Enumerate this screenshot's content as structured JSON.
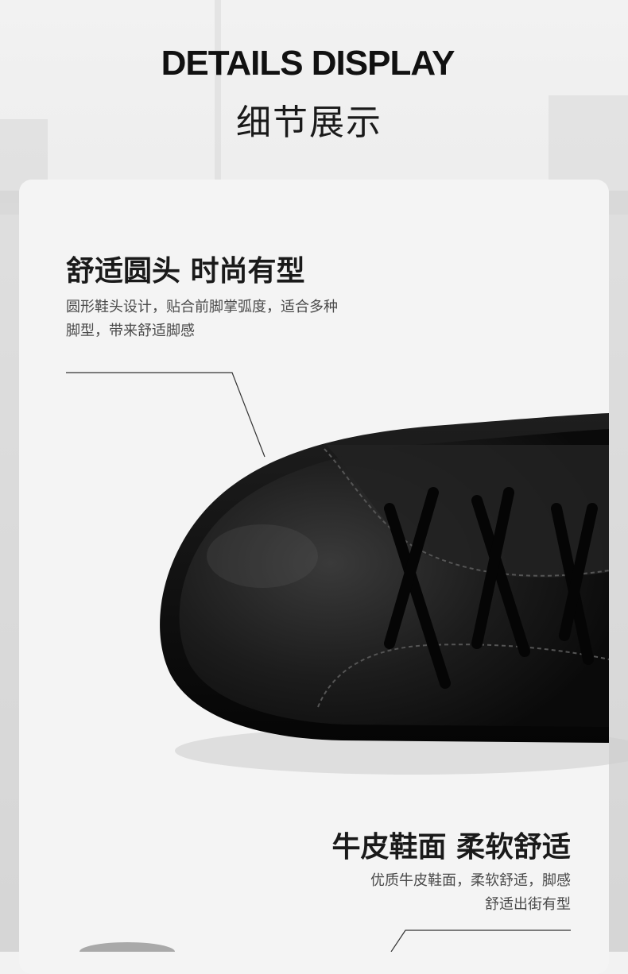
{
  "header": {
    "title_en": "DETAILS DISPLAY",
    "title_cn": "细节展示"
  },
  "features": [
    {
      "title": "舒适圆头 时尚有型",
      "desc_line1": "圆形鞋头设计，贴合前脚掌弧度，适合多种",
      "desc_line2": "脚型，带来舒适脚感"
    },
    {
      "title": "牛皮鞋面 柔软舒适",
      "desc_line1": "优质牛皮鞋面，柔软舒适，脚感",
      "desc_line2": "舒适出街有型"
    }
  ],
  "colors": {
    "text_dark": "#1a1a1a",
    "text_body": "#4a4a4a",
    "card_bg": "#f4f4f4",
    "shoe": "#141414"
  },
  "icons": {
    "shoe_image": "black-leather-sneaker-toe"
  }
}
